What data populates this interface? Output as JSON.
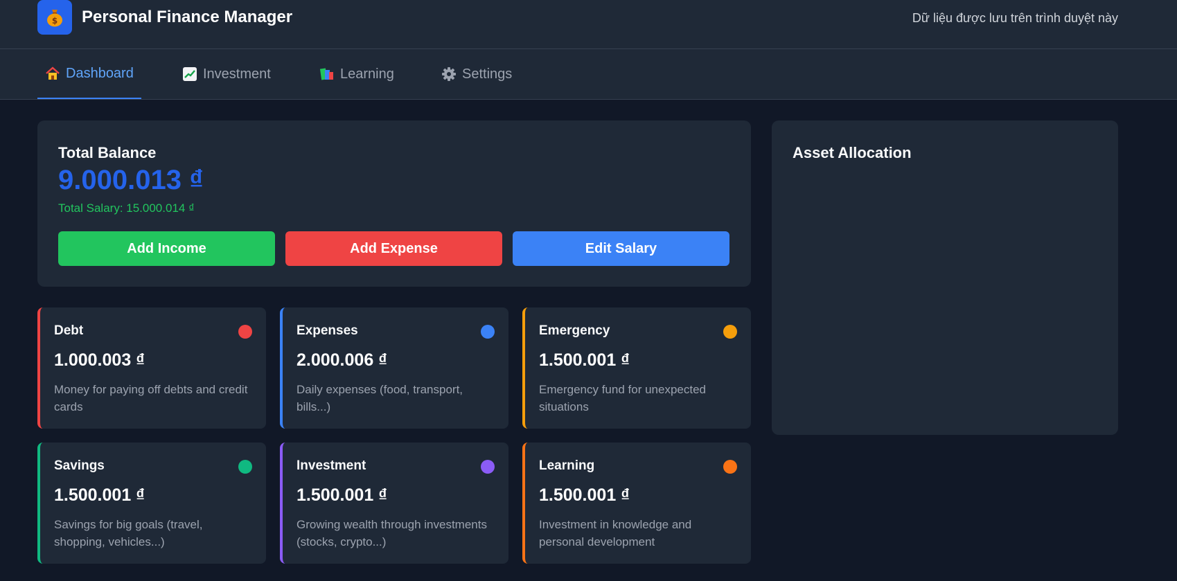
{
  "header": {
    "logo_icon": "money-bag-icon",
    "title": "Personal Finance Manager",
    "storage_note": "Dữ liệu được lưu trên trình duyệt này"
  },
  "nav": {
    "tabs": [
      {
        "label": "Dashboard",
        "icon": "house-icon",
        "active": true
      },
      {
        "label": "Investment",
        "icon": "chart-increasing-icon",
        "active": false
      },
      {
        "label": "Learning",
        "icon": "books-icon",
        "active": false
      },
      {
        "label": "Settings",
        "icon": "gear-icon",
        "active": false
      }
    ]
  },
  "balance": {
    "label": "Total Balance",
    "value": "9.000.013 ₫",
    "salary": "Total Salary: 15.000.014 ₫",
    "buttons": {
      "add_income": "Add Income",
      "add_expense": "Add Expense",
      "edit_salary": "Edit Salary"
    }
  },
  "allocation": {
    "title": "Asset Allocation"
  },
  "funds": [
    {
      "name": "Debt",
      "amount": "1.000.003 ₫",
      "description": "Money for paying off debts and credit cards",
      "color": "#ef4444"
    },
    {
      "name": "Expenses",
      "amount": "2.000.006 ₫",
      "description": "Daily expenses (food, transport, bills...)",
      "color": "#3b82f6"
    },
    {
      "name": "Emergency",
      "amount": "1.500.001 ₫",
      "description": "Emergency fund for unexpected situations",
      "color": "#f59e0b"
    },
    {
      "name": "Savings",
      "amount": "1.500.001 ₫",
      "description": "Savings for big goals (travel, shopping, vehicles...)",
      "color": "#10b981"
    },
    {
      "name": "Investment",
      "amount": "1.500.001 ₫",
      "description": "Growing wealth through investments (stocks, crypto...)",
      "color": "#8b5cf6"
    },
    {
      "name": "Learning",
      "amount": "1.500.001 ₫",
      "description": "Investment in knowledge and personal development",
      "color": "#f97316"
    }
  ],
  "colors": {
    "background": "#111827",
    "surface": "#1f2937",
    "accent": "#3b82f6",
    "income": "#22c55e",
    "expense": "#ef4444",
    "balance": "#2563eb"
  }
}
